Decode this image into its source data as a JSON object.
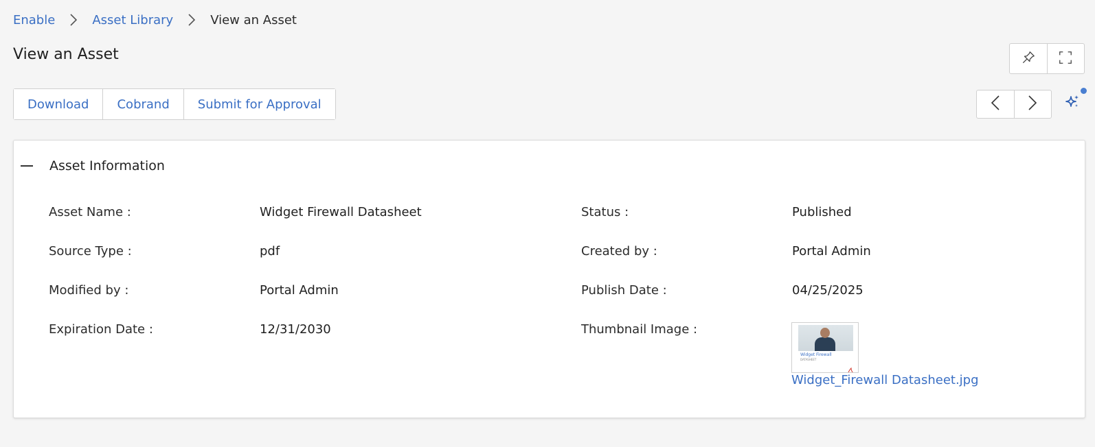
{
  "breadcrumb": {
    "items": [
      "Enable",
      "Asset Library",
      "View an Asset"
    ]
  },
  "page": {
    "title": "View an Asset"
  },
  "toolbar": {
    "download_label": "Download",
    "cobrand_label": "Cobrand",
    "submit_label": "Submit for Approval"
  },
  "icons": {
    "pin": "pin-icon",
    "fullscreen": "fullscreen-icon",
    "prev": "chevron-left-icon",
    "next": "chevron-right-icon",
    "ai": "sparkle-icon"
  },
  "panel": {
    "title": "Asset Information",
    "fields": {
      "asset_name": {
        "label": "Asset Name :",
        "value": "Widget Firewall Datasheet"
      },
      "source_type": {
        "label": "Source Type :",
        "value": "pdf"
      },
      "modified_by": {
        "label": "Modified by :",
        "value": "Portal Admin"
      },
      "expiration_date": {
        "label": "Expiration Date :",
        "value": "12/31/2030"
      },
      "status": {
        "label": "Status :",
        "value": "Published"
      },
      "created_by": {
        "label": "Created by :",
        "value": "Portal Admin"
      },
      "publish_date": {
        "label": "Publish Date :",
        "value": "04/25/2025"
      },
      "thumbnail": {
        "label": "Thumbnail Image :",
        "thumb_title": "Widget Firewall",
        "thumb_subtitle": "DATASHEET",
        "file_name": "Widget_Firewall Datasheet.jpg"
      }
    }
  },
  "colors": {
    "accent": "#3a6fc4",
    "notification_dot": "#4a7fd1",
    "background": "#f5f5f5"
  }
}
